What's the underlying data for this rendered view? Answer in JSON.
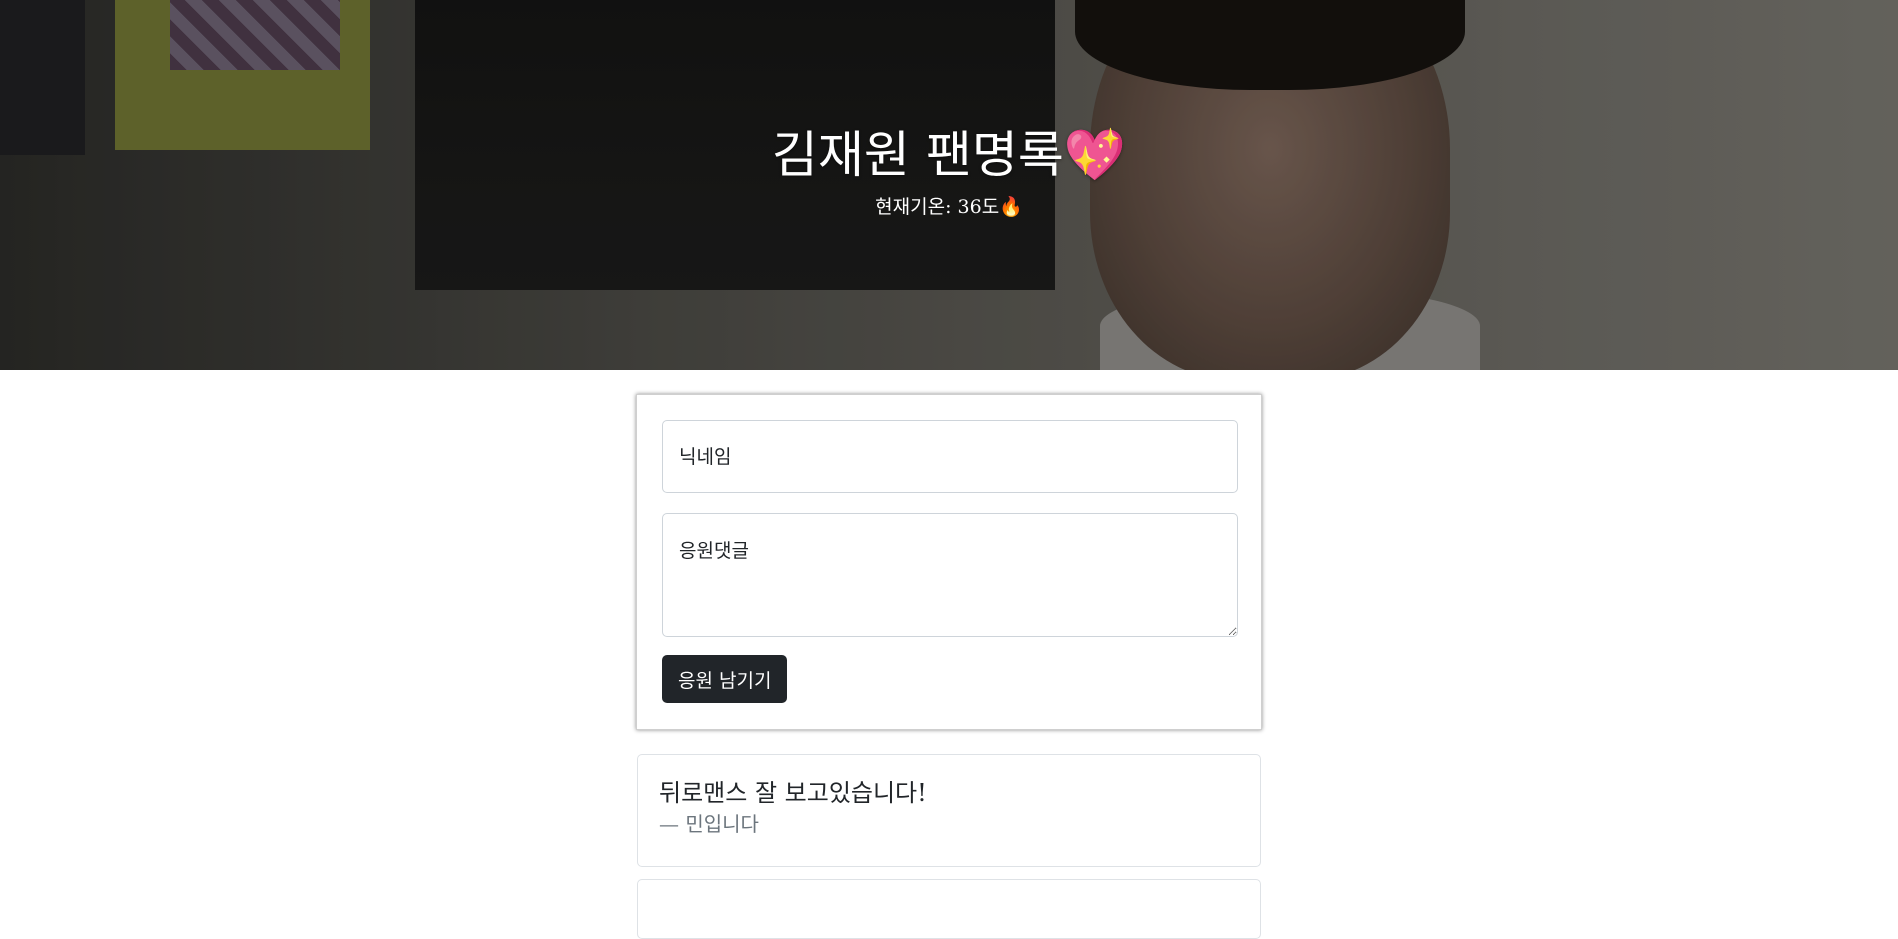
{
  "hero": {
    "title": "김재원 팬명록💖",
    "subtitle": "현재기온: 36도🔥"
  },
  "form": {
    "nickname_placeholder": "닉네임",
    "comment_placeholder": "응원댓글",
    "submit_label": "응원 남기기"
  },
  "comments": [
    {
      "text": "뒤로맨스 잘 보고있습니다!",
      "author": "— 민입니다"
    }
  ],
  "colors": {
    "button_bg": "#212529",
    "author_text": "#6c757d"
  }
}
